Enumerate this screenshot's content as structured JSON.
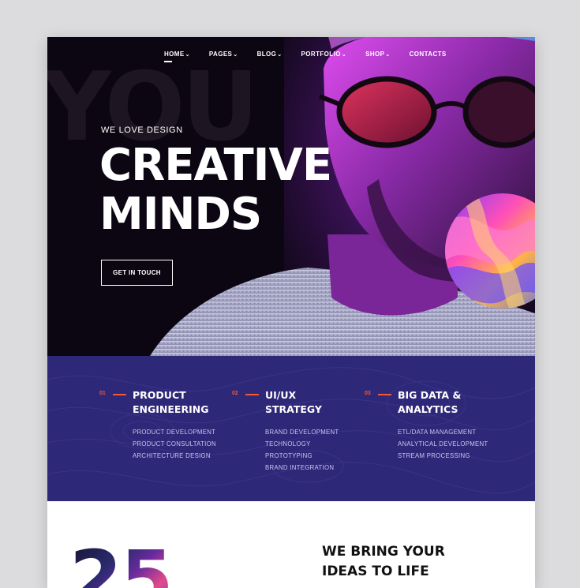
{
  "nav": {
    "items": [
      {
        "label": "HOME",
        "has_dropdown": true,
        "active": true
      },
      {
        "label": "PAGES",
        "has_dropdown": true
      },
      {
        "label": "BLOG",
        "has_dropdown": true
      },
      {
        "label": "PORTFOLIO",
        "has_dropdown": true
      },
      {
        "label": "SHOP",
        "has_dropdown": true
      },
      {
        "label": "CONTACTS",
        "has_dropdown": false
      }
    ]
  },
  "hero": {
    "bg_text": "YOU",
    "eyebrow": "WE LOVE DESIGN",
    "headline_line1": "CREATIVE",
    "headline_line2": "MINDS",
    "cta_label": "GET IN TOUCH"
  },
  "services": [
    {
      "num": "01",
      "title_line1": "PRODUCT",
      "title_line2": "ENGINEERING",
      "items": [
        "PRODUCT DEVELOPMENT",
        "PRODUCT CONSULTATION",
        "ARCHITECTURE DESIGN"
      ]
    },
    {
      "num": "02",
      "title_line1": "UI/UX",
      "title_line2": "STRATEGY",
      "items": [
        "BRAND DEVELOPMENT",
        "TECHNOLOGY",
        "PROTOTYPING",
        "BRAND INTEGRATION"
      ]
    },
    {
      "num": "03",
      "title_line1": "BIG DATA &",
      "title_line2": "ANALYTICS",
      "items": [
        "ETL/DATA MANAGEMENT",
        "ANALYTICAL DEVELOPMENT",
        "STREAM PROCESSING"
      ]
    }
  ],
  "about": {
    "big_number": "25",
    "tagline_line1": "WE BRING YOUR",
    "tagline_line2": "IDEAS TO LIFE"
  },
  "colors": {
    "accent": "#f05a3a",
    "services_bg": "#2e2878",
    "hero_bg": "#0c0612",
    "magenta_light": "#c234e6"
  },
  "icons": [
    "chevron-down-icon"
  ]
}
